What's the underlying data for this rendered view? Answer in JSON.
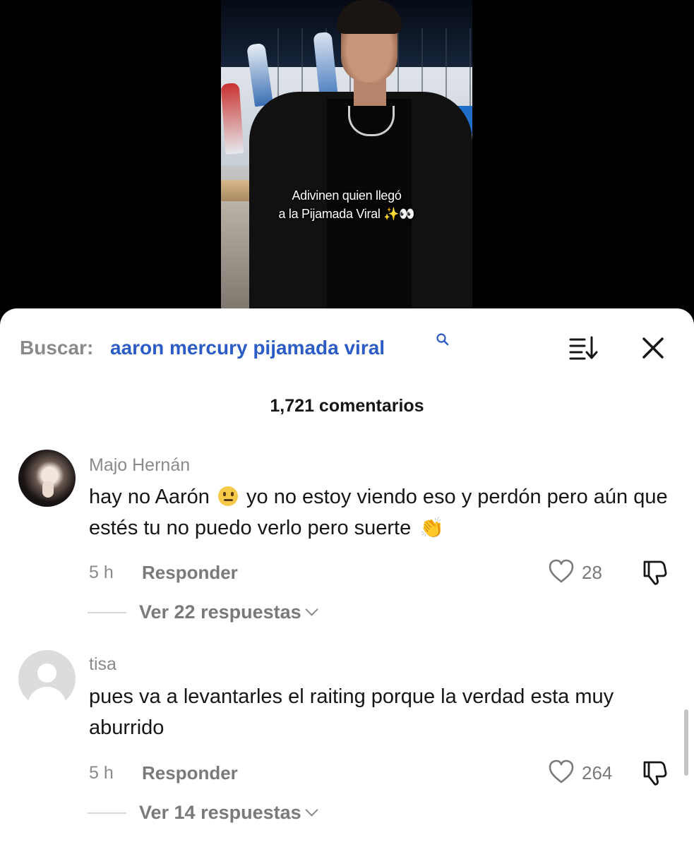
{
  "video": {
    "caption_line1": "Adivinen quien llegó",
    "caption_line2": "a la Pijamada Viral ✨👀"
  },
  "search": {
    "label": "Buscar:",
    "term": "aaron mercury pijamada viral",
    "icons": [
      "search-icon",
      "sort-icon",
      "close-icon"
    ]
  },
  "comments_header": {
    "count_text": "1,721 comentarios"
  },
  "comments": [
    {
      "username": "Majo Hernán",
      "text_part1": "hay no Aarón",
      "text_part2": " yo no estoy viendo eso y perdón pero aún que estés tu no puedo verlo pero suerte",
      "emoji1": "neutral-face-emoji",
      "emoji2": "👏",
      "time": "5 h",
      "reply_label": "Responder",
      "likes": "28",
      "view_replies": "Ver 22 respuestas"
    },
    {
      "username": "tisa",
      "text": "pues va a levantarles el raiting porque la verdad esta muy aburrido",
      "time": "5 h",
      "reply_label": "Responder",
      "likes": "264",
      "view_replies": "Ver 14 respuestas"
    }
  ],
  "colors": {
    "search_term": "#2c5cc5",
    "muted_text": "#8a8a8a",
    "primary_text": "#161616",
    "sheet_background": "#ffffff"
  }
}
